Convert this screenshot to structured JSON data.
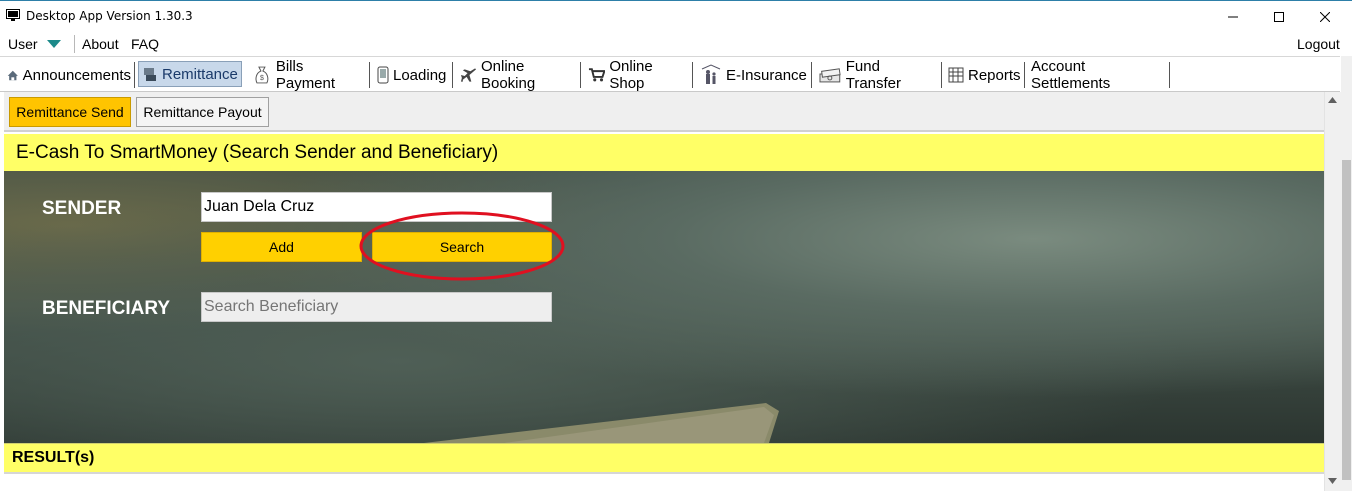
{
  "window": {
    "title": "Desktop App Version 1.30.3",
    "controls": {
      "minimize": "—",
      "maximize": "☐",
      "close": "✕"
    }
  },
  "menu": {
    "user": "User",
    "about": "About",
    "faq": "FAQ",
    "logout": "Logout"
  },
  "tabs": [
    {
      "label": "Announcements",
      "icon": "home-icon",
      "active": false
    },
    {
      "label": "Remittance",
      "icon": "remittance-icon",
      "active": true
    },
    {
      "label": "Bills Payment",
      "icon": "money-bag-icon",
      "active": false
    },
    {
      "label": "Loading",
      "icon": "phone-icon",
      "active": false
    },
    {
      "label": "Online Booking",
      "icon": "airplane-icon",
      "active": false
    },
    {
      "label": "Online Shop",
      "icon": "cart-icon",
      "active": false
    },
    {
      "label": "E-Insurance",
      "icon": "family-icon",
      "active": false
    },
    {
      "label": "Fund Transfer",
      "icon": "cash-stack-icon",
      "active": false
    },
    {
      "label": "Reports",
      "icon": "report-icon",
      "active": false
    },
    {
      "label": "Account Settlements",
      "icon": "",
      "active": false
    }
  ],
  "subtabs": {
    "send": "Remittance Send",
    "payout": "Remittance Payout"
  },
  "header": "E-Cash To SmartMoney (Search Sender and Beneficiary)",
  "form": {
    "sender_label": "SENDER",
    "sender_value": "Juan Dela Cruz",
    "add_label": "Add",
    "search_label": "Search",
    "beneficiary_label": "BENEFICIARY",
    "beneficiary_placeholder": "Search Beneficiary"
  },
  "result_label": "RESULT(s)",
  "colors": {
    "highlight_yellow": "#ffff66",
    "button_yellow": "#ffd000",
    "annotation_red": "#e01020"
  }
}
